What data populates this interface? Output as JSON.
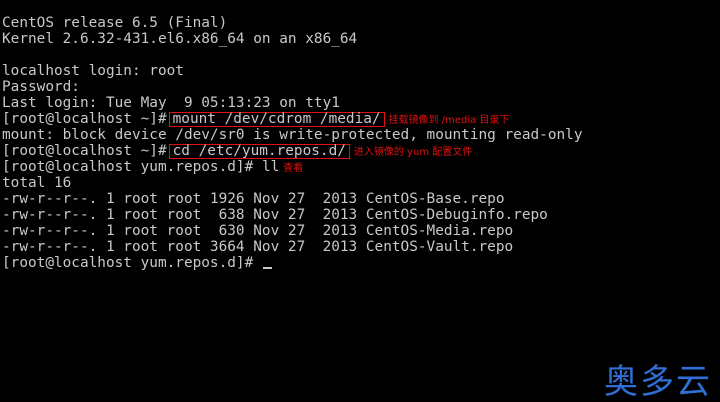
{
  "terminal": {
    "lines": {
      "release": "CentOS release 6.5 (Final)",
      "kernel": "Kernel 2.6.32-431.el6.x86_64 on an x86_64",
      "login": "localhost login: root",
      "password": "Password:",
      "last_login": "Last login: Tue May  9 05:13:23 on tty1",
      "prompt_home": "[root@localhost ~]#",
      "mount_cmd": "mount /dev/cdrom /media/",
      "mount_annotation": "挂载镜像到 /media 目录下",
      "mount_warning": "mount: block device /dev/sr0 is write-protected, mounting read-only",
      "cd_cmd": "cd /etc/yum.repos.d/",
      "cd_annotation": "进入镜像的 yum 配置文件",
      "prompt_repos": "[root@localhost yum.repos.d]#",
      "ll_cmd": "ll",
      "ll_annotation": "查看",
      "total": "total 16",
      "files": [
        "-rw-r--r--. 1 root root 1926 Nov 27  2013 CentOS-Base.repo",
        "-rw-r--r--. 1 root root  638 Nov 27  2013 CentOS-Debuginfo.repo",
        "-rw-r--r--. 1 root root  630 Nov 27  2013 CentOS-Media.repo",
        "-rw-r--r--. 1 root root 3664 Nov 27  2013 CentOS-Vault.repo"
      ]
    }
  },
  "watermark": "奥多云",
  "colors": {
    "background": "#000000",
    "text": "#c8c8c8",
    "annotation": "#e01010",
    "watermark": "#2f6fd6"
  }
}
